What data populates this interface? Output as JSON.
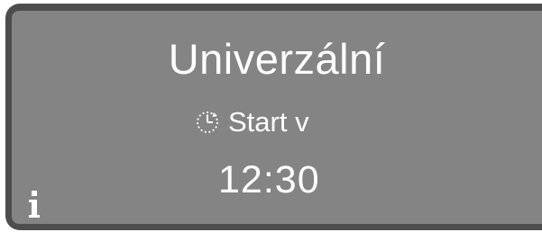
{
  "display": {
    "program_name": "Univerzální",
    "start_label": "Start v",
    "start_time": "12:30"
  },
  "icons": {
    "delay_start": "clock-icon",
    "info": "info-icon"
  },
  "colors": {
    "bezel": "#4d4d4d",
    "screen": "#848484",
    "text": "#ffffff"
  }
}
